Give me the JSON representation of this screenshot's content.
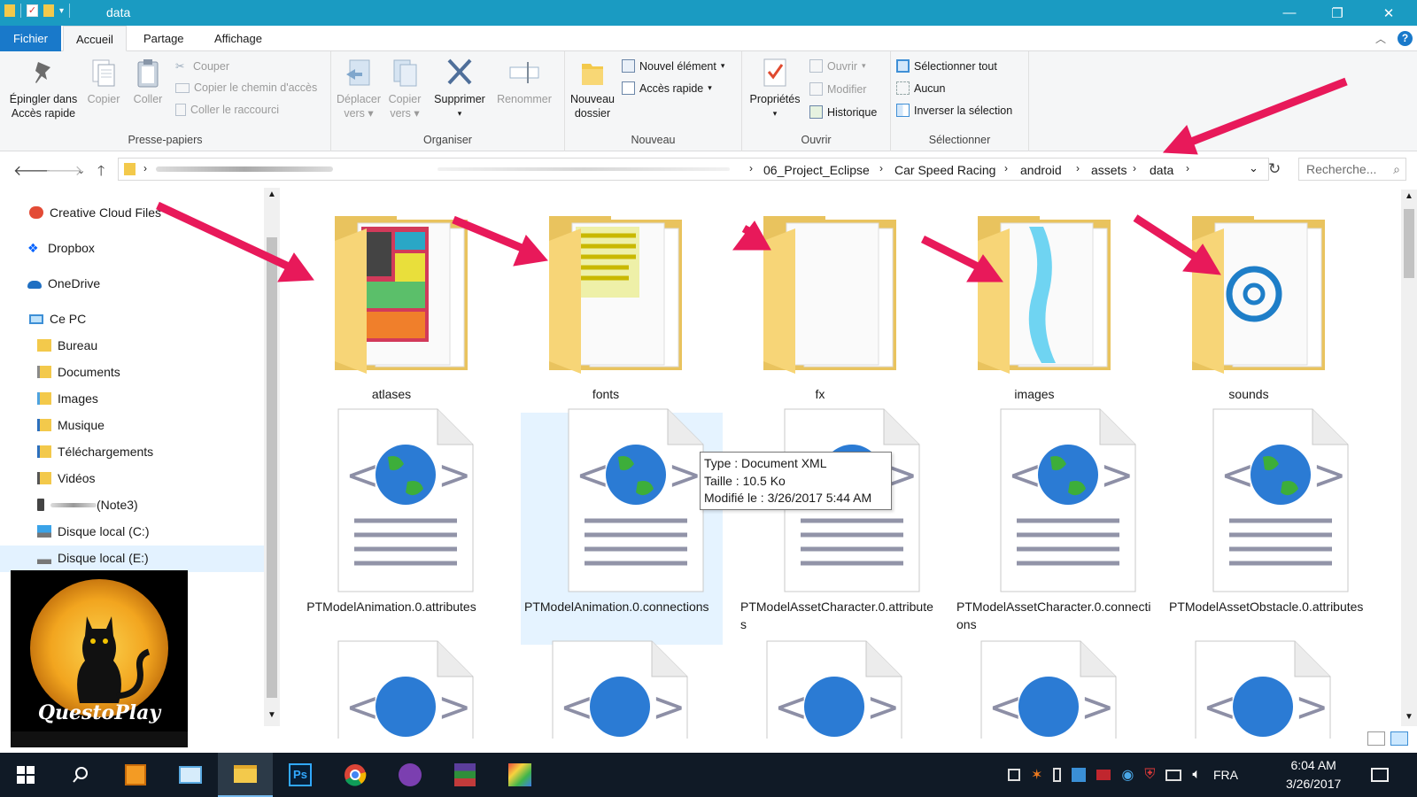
{
  "window": {
    "title": "data",
    "controls": {
      "minimize": "—",
      "maximize": "❐",
      "close": "✕"
    }
  },
  "ribbon_tabs": [
    {
      "label": "Fichier"
    },
    {
      "label": "Accueil"
    },
    {
      "label": "Partage"
    },
    {
      "label": "Affichage"
    }
  ],
  "ribbon": {
    "presse_papiers": {
      "label": "Presse-papiers",
      "pin_line1": "Épingler dans",
      "pin_line2": "Accès rapide",
      "copy": "Copier",
      "paste": "Coller",
      "cut": "Couper",
      "copy_path": "Copier le chemin d'accès",
      "paste_shortcut": "Coller le raccourci"
    },
    "organiser": {
      "label": "Organiser",
      "move_line1": "Déplacer",
      "move_line2": "vers",
      "copyto_line1": "Copier",
      "copyto_line2": "vers",
      "delete": "Supprimer",
      "rename": "Renommer"
    },
    "nouveau": {
      "label": "Nouveau",
      "new_folder_line1": "Nouveau",
      "new_folder_line2": "dossier",
      "new_item": "Nouvel élément",
      "quick_access": "Accès rapide"
    },
    "ouvrir": {
      "label": "Ouvrir",
      "properties": "Propriétés",
      "open": "Ouvrir",
      "edit": "Modifier",
      "history": "Historique"
    },
    "selectionner": {
      "label": "Sélectionner",
      "select_all": "Sélectionner tout",
      "none": "Aucun",
      "invert": "Inverser la sélection"
    }
  },
  "address": {
    "breadcrumbs": [
      "06_Project_Eclipse",
      "Car Speed Racing",
      "android",
      "assets",
      "data"
    ],
    "search_placeholder": "Recherche..."
  },
  "nav_pane": {
    "items": [
      {
        "label": "Creative Cloud Files",
        "icon": "creative-cloud-icon"
      },
      {
        "label": "Dropbox",
        "icon": "dropbox-icon"
      },
      {
        "label": "OneDrive",
        "icon": "onedrive-icon"
      },
      {
        "label": "Ce PC",
        "icon": "computer-icon"
      },
      {
        "label": "Bureau",
        "icon": "folder-icon"
      },
      {
        "label": "Documents",
        "icon": "documents-icon"
      },
      {
        "label": "Images",
        "icon": "images-icon"
      },
      {
        "label": "Musique",
        "icon": "music-icon"
      },
      {
        "label": "Téléchargements",
        "icon": "downloads-icon"
      },
      {
        "label": "Vidéos",
        "icon": "videos-icon"
      },
      {
        "label": "(Note3)",
        "icon": "phone-icon"
      },
      {
        "label": "Disque local (C:)",
        "icon": "drive-icon"
      },
      {
        "label": "Disque local (E:)",
        "icon": "drive-icon"
      }
    ],
    "selected": "Disque local (E:)"
  },
  "logo": {
    "text": "QuestoPlay"
  },
  "content": {
    "folders": [
      "atlases",
      "fonts",
      "fx",
      "images",
      "sounds"
    ],
    "files": [
      "PTModelAnimation.0.attributes",
      "PTModelAnimation.0.connections",
      "PTModelAssetCharacter.0.attributes",
      "PTModelAssetCharacter.0.connections",
      "PTModelAssetObstacle.0.attributes"
    ],
    "selected_file": "PTModelAnimation.0.connections"
  },
  "tooltip": {
    "type": "Type : Document XML",
    "size": "Taille : 10.5 Ko",
    "modified": "Modifié le : 3/26/2017 5:44 AM"
  },
  "taskbar": {
    "apps": [
      "start-icon",
      "search-icon",
      "package-icon",
      "control-panel-icon",
      "file-explorer-icon",
      "photoshop-icon",
      "chrome-icon",
      "nvu-icon",
      "winrar-icon",
      "studio-icon"
    ],
    "photoshop_label": "Ps",
    "language": "FRA",
    "time": "6:04 AM",
    "date": "3/26/2017"
  },
  "colors": {
    "titlebar": "#1a9bc2",
    "file_tab": "#1979ca",
    "selection": "#cce8ff",
    "arrow": "#e8195a",
    "taskbar": "#101a26"
  }
}
